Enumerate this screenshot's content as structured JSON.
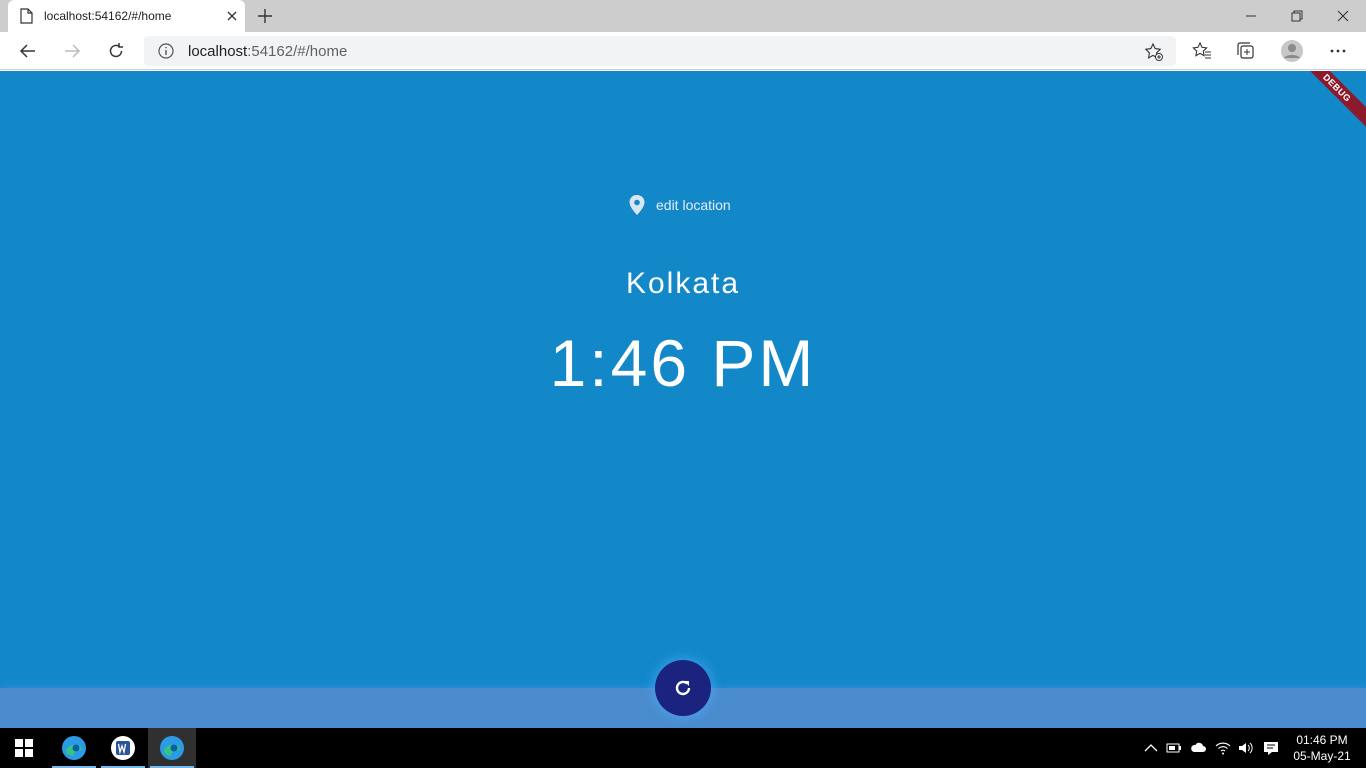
{
  "browser": {
    "tab_title": "localhost:54162/#/home",
    "url_host": "localhost",
    "url_rest": ":54162/#/home"
  },
  "app": {
    "debug_label": "DEBUG",
    "edit_location_label": "edit location",
    "city": "Kolkata",
    "time": "1:46 PM",
    "background_color": "#1288c9",
    "fab_color": "#1a237e"
  },
  "taskbar": {
    "time": "01:46 PM",
    "date": "05-May-21"
  }
}
